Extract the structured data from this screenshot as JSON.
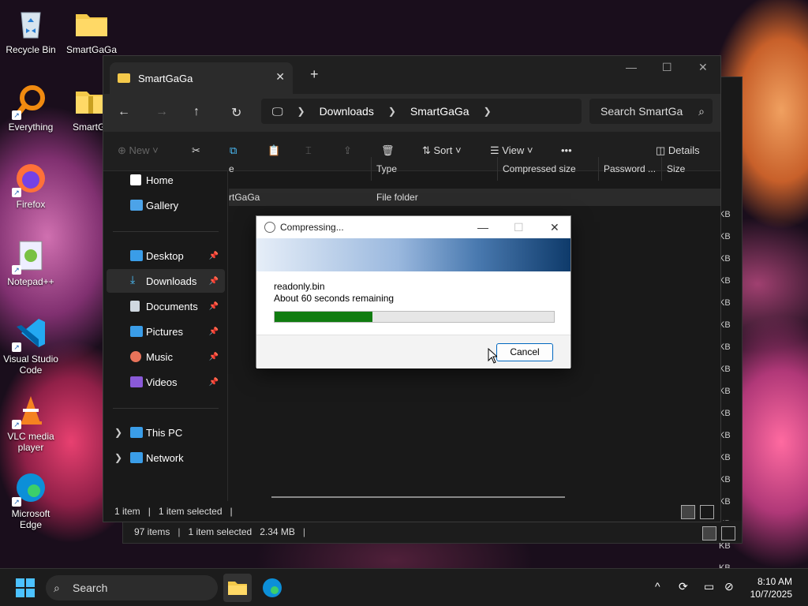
{
  "desktop": {
    "icons": [
      {
        "label": "Recycle Bin"
      },
      {
        "label": "SmartGaGa"
      },
      {
        "label": "Everything"
      },
      {
        "label": "SmartGa"
      },
      {
        "label": "Firefox"
      },
      {
        "label": "Notepad++"
      },
      {
        "label": "Visual Studio Code"
      },
      {
        "label": "VLC media player"
      },
      {
        "label": "Microsoft Edge"
      }
    ]
  },
  "explorer": {
    "tab_title": "SmartGaGa",
    "new_tab": "+",
    "breadcrumb": [
      "Downloads",
      "SmartGaGa"
    ],
    "search_placeholder": "Search SmartGa",
    "toolbar": {
      "new_label": "New",
      "sort_label": "Sort",
      "view_label": "View",
      "more_label": "•••",
      "details_label": "Details"
    },
    "sidebar": {
      "home": "Home",
      "gallery": "Gallery",
      "desktop": "Desktop",
      "downloads": "Downloads",
      "documents": "Documents",
      "pictures": "Pictures",
      "music": "Music",
      "videos": "Videos",
      "this_pc": "This PC",
      "network": "Network"
    },
    "columns": {
      "name_partial": "e",
      "type": "Type",
      "compressed_size": "Compressed size",
      "password": "Password ...",
      "size": "Size"
    },
    "row": {
      "name_partial": "rtGaGa",
      "type": "File folder"
    },
    "status": {
      "items": "1 item",
      "selected": "1 item selected"
    }
  },
  "bg_explorer": {
    "status": {
      "items": "97 items",
      "selected": "1 item selected",
      "size": "2.34 MB"
    },
    "size_col": [
      "KB",
      "KB",
      "KB",
      "KB",
      "KB",
      "KB",
      "KB",
      "KB",
      "KB",
      "KB",
      "KB",
      "KB",
      "KB",
      "KB",
      "KB",
      "KB",
      "KB"
    ]
  },
  "dialog": {
    "title": "Compressing...",
    "filename": "readonly.bin",
    "remaining": "About 60 seconds remaining",
    "progress_fraction": 0.35,
    "cancel_label": "Cancel"
  },
  "taskbar": {
    "search_placeholder": "Search",
    "time": "8:10 AM",
    "date": "10/7/2025"
  },
  "colors": {
    "progress": "#107c10",
    "accent": "#0067c0",
    "start": "#4cc2ff"
  }
}
